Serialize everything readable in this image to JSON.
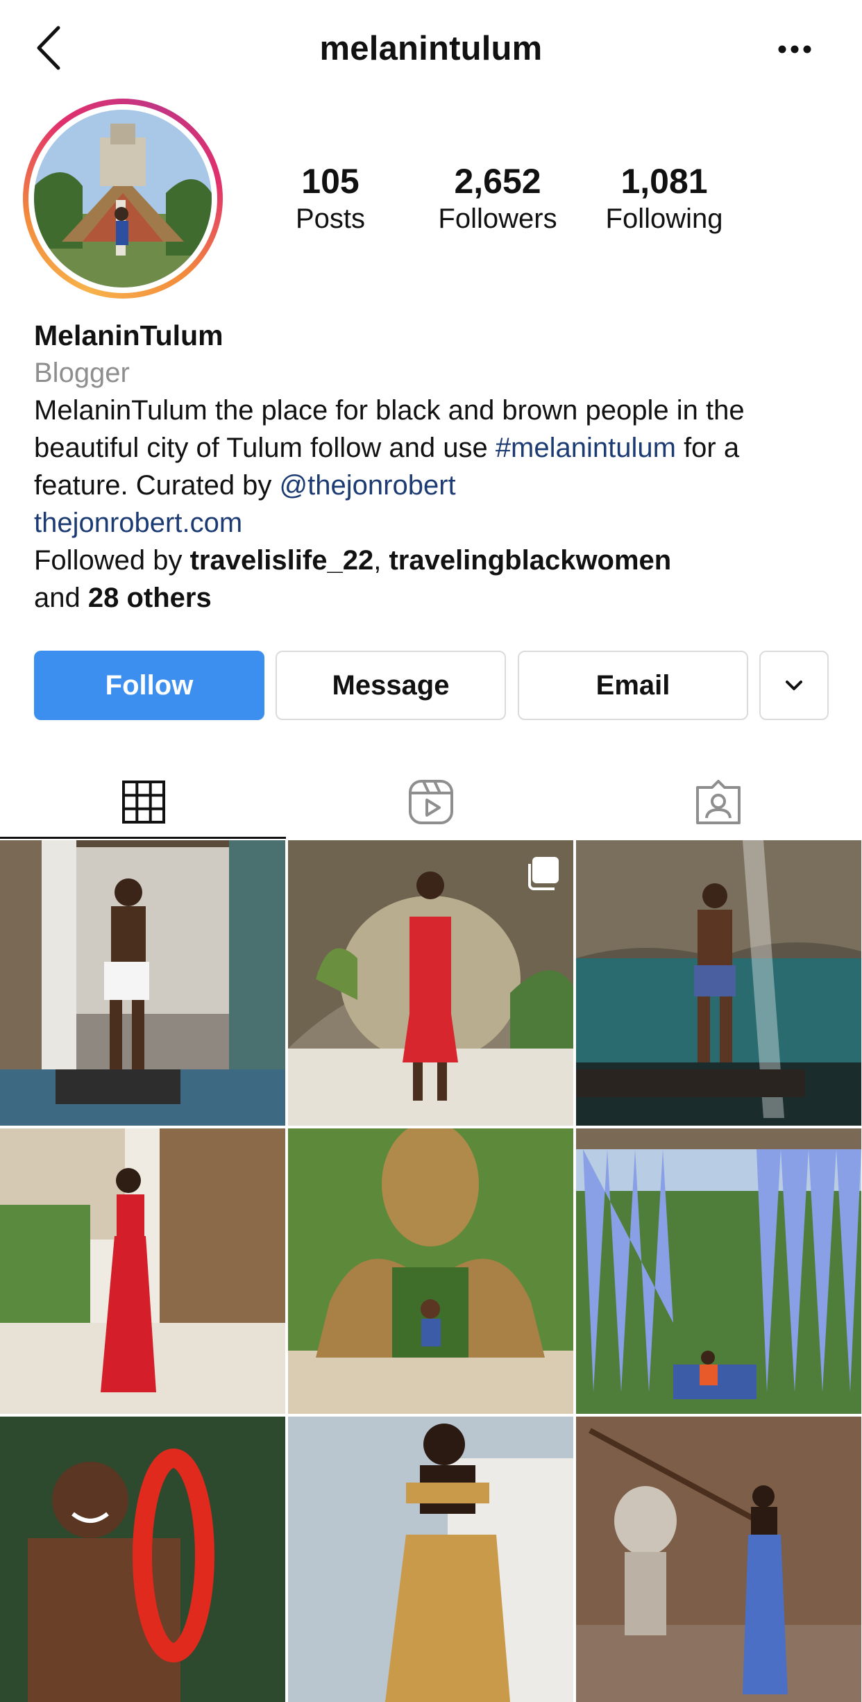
{
  "header": {
    "username": "melanintulum",
    "back_icon": "chevron-left-icon",
    "more_icon": "more-horizontal-icon"
  },
  "profile": {
    "avatar_ring_colors": [
      "#f7b24a",
      "#e1306c",
      "#c13584"
    ],
    "stats": [
      {
        "value": "105",
        "label": "Posts"
      },
      {
        "value": "2,652",
        "label": "Followers"
      },
      {
        "value": "1,081",
        "label": "Following"
      }
    ]
  },
  "bio": {
    "name": "MelaninTulum",
    "category": "Blogger",
    "text_part1": "MelaninTulum the place for black and brown people in the beautiful city of Tulum follow and use ",
    "hashtag": "#melanintulum",
    "text_part2": " for a feature. Curated by ",
    "mention": "@thejonrobert",
    "website": "thejonrobert.com",
    "followed_by_prefix": "Followed by ",
    "followed_by_user1": "travelislife_22",
    "followed_by_sep": ", ",
    "followed_by_user2": "travelingblackwomen",
    "followed_by_and": "and ",
    "followed_by_others": "28 others"
  },
  "actions": {
    "follow": "Follow",
    "message": "Message",
    "email": "Email",
    "more_icon": "chevron-down-icon"
  },
  "tabs": [
    {
      "icon": "grid-icon",
      "active": true
    },
    {
      "icon": "reels-icon",
      "active": false
    },
    {
      "icon": "tagged-icon",
      "active": false
    }
  ],
  "colors": {
    "accent": "#3c8fee",
    "link": "#1d3b73",
    "muted": "#8e8e8e",
    "border": "#dbdbdb"
  },
  "grid": {
    "posts": [
      {
        "subject": "man in white shorts at villa",
        "carousel": false
      },
      {
        "subject": "woman in red dress in stone tunnel",
        "carousel": true
      },
      {
        "subject": "man in blue shorts in cenote",
        "carousel": false
      },
      {
        "subject": "woman in red tiered gown on sand path",
        "carousel": false
      },
      {
        "subject": "man before giant wooden sculpture",
        "carousel": false
      },
      {
        "subject": "blue fabric curtains with woman in orange",
        "carousel": false
      },
      {
        "subject": "smiling man with red float",
        "carousel": false
      },
      {
        "subject": "woman in skirt against white wall",
        "carousel": false
      },
      {
        "subject": "woman in blue dress on staircase",
        "carousel": false
      }
    ]
  }
}
